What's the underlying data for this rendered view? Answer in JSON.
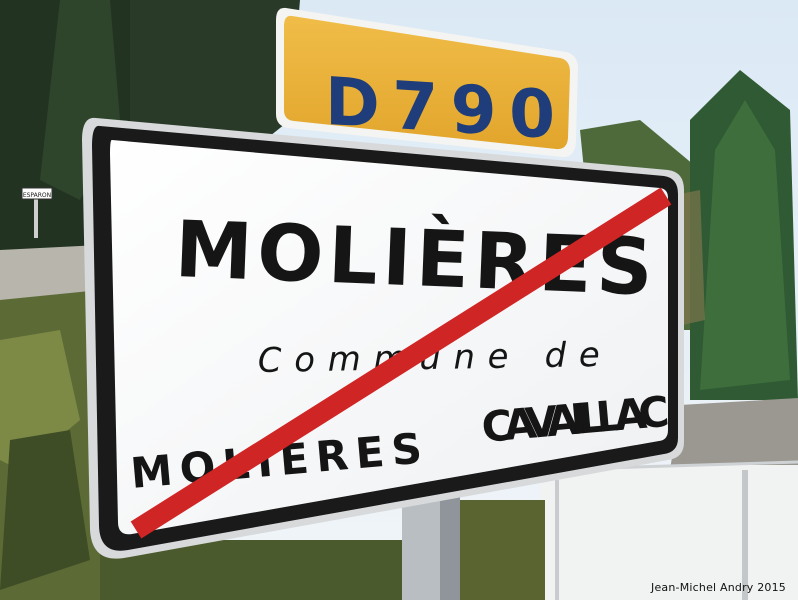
{
  "route_plate": {
    "text": "D790"
  },
  "sign": {
    "town": "MOLIÈRES",
    "line_commune": "Commune de",
    "commune_left": "MOLIÈRES",
    "commune_right": "CAVAILLAC"
  },
  "small_sign": {
    "text": "ESPARON"
  },
  "credit": "Jean-Michel Andry 2015",
  "colors": {
    "sky": "#e9f0f6",
    "plate": "#eab238",
    "sign_face": "#f7f7f7",
    "sign_border": "#1a1a1a",
    "strike": "#d02525",
    "text": "#151515"
  }
}
